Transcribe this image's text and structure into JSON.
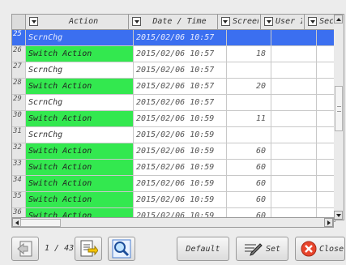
{
  "headers": {
    "action": "Action",
    "date": "Date / Time",
    "screen": "Screen No",
    "user": "User ID",
    "security": "Security"
  },
  "rows": [
    {
      "no": "25",
      "action": "ScrnChg",
      "date": "2015/02/06 10:57",
      "screen": "",
      "green": false,
      "selected": true
    },
    {
      "no": "26",
      "action": "Switch Action",
      "date": "2015/02/06 10:57",
      "screen": "18",
      "green": true,
      "selected": false
    },
    {
      "no": "27",
      "action": "ScrnChg",
      "date": "2015/02/06 10:57",
      "screen": "",
      "green": false,
      "selected": false
    },
    {
      "no": "28",
      "action": "Switch Action",
      "date": "2015/02/06 10:57",
      "screen": "20",
      "green": true,
      "selected": false
    },
    {
      "no": "29",
      "action": "ScrnChg",
      "date": "2015/02/06 10:57",
      "screen": "",
      "green": false,
      "selected": false
    },
    {
      "no": "30",
      "action": "Switch Action",
      "date": "2015/02/06 10:59",
      "screen": "11",
      "green": true,
      "selected": false
    },
    {
      "no": "31",
      "action": "ScrnChg",
      "date": "2015/02/06 10:59",
      "screen": "",
      "green": false,
      "selected": false
    },
    {
      "no": "32",
      "action": "Switch Action",
      "date": "2015/02/06 10:59",
      "screen": "60",
      "green": true,
      "selected": false
    },
    {
      "no": "33",
      "action": "Switch Action",
      "date": "2015/02/06 10:59",
      "screen": "60",
      "green": true,
      "selected": false
    },
    {
      "no": "34",
      "action": "Switch Action",
      "date": "2015/02/06 10:59",
      "screen": "60",
      "green": true,
      "selected": false
    },
    {
      "no": "35",
      "action": "Switch Action",
      "date": "2015/02/06 10:59",
      "screen": "60",
      "green": true,
      "selected": false
    },
    {
      "no": "36",
      "action": "Switch Action",
      "date": "2015/02/06 10:59",
      "screen": "60",
      "green": true,
      "selected": false
    }
  ],
  "pager": {
    "text": "1 / 43"
  },
  "toolbar": {
    "default_label": "Default",
    "set_label": "Set",
    "close_label": "Close"
  },
  "icons": {
    "prev": "previous-page-icon",
    "next": "next-page-icon",
    "search": "magnifier-icon",
    "set": "pen-icon",
    "close": "close-x-icon"
  },
  "colors": {
    "selected_row": "#3b6ff0",
    "switch_action": "#33e84f",
    "close_icon": "#e8452c"
  }
}
